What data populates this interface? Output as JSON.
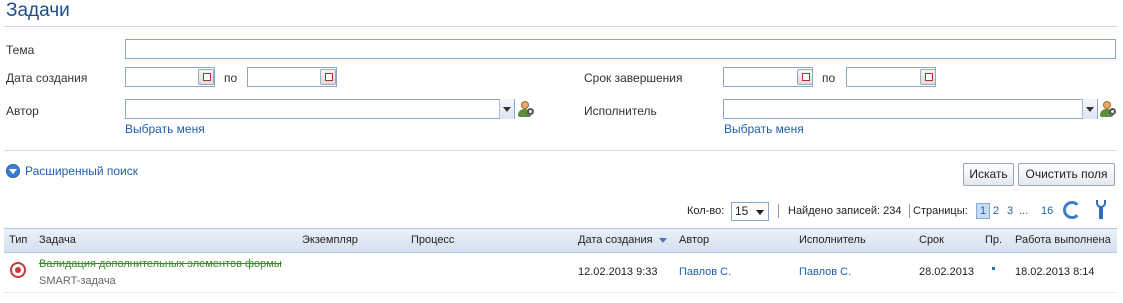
{
  "page": {
    "title": "Задачи"
  },
  "filters": {
    "topic_label": "Тема",
    "topic_value": "",
    "created_label": "Дата создания",
    "to_label_1": "по",
    "due_label": "Срок завершения",
    "to_label_2": "по",
    "author_label": "Автор",
    "author_value": "",
    "author_pick_me": "Выбрать меня",
    "executor_label": "Исполнитель",
    "executor_value": "",
    "executor_pick_me": "Выбрать меня"
  },
  "advanced_search_label": "Расширенный поиск",
  "buttons": {
    "search": "Искать",
    "clear": "Очистить поля"
  },
  "pager": {
    "qty_label": "Кол-во:",
    "qty_value": "15",
    "found_label": "Найдено записей: 234",
    "pages_label": "Страницы:",
    "pages": [
      "1",
      "2",
      "3",
      "...",
      "16"
    ],
    "current_page": "1"
  },
  "table": {
    "headers": {
      "type": "Тип",
      "task": "Задача",
      "instance": "Экземпляр",
      "process": "Процесс",
      "created": "Дата создания",
      "author": "Автор",
      "executor": "Исполнитель",
      "due": "Срок",
      "priority": "Пр.",
      "completed": "Работа выполнена"
    },
    "rows": [
      {
        "icon": "target-icon",
        "task": "Валидация дополнительных элементов формы",
        "task_type": "SMART-задача",
        "instance": "",
        "process": "",
        "created": "12.02.2013 9:33",
        "author": "Павлов С.",
        "executor": "Павлов С.",
        "due": "28.02.2013",
        "completed": "18.02.2013 8:14"
      }
    ]
  },
  "colors": {
    "accent": "#1f5fb0",
    "title": "#1f4e8c",
    "done_task": "#3a8a2a"
  }
}
